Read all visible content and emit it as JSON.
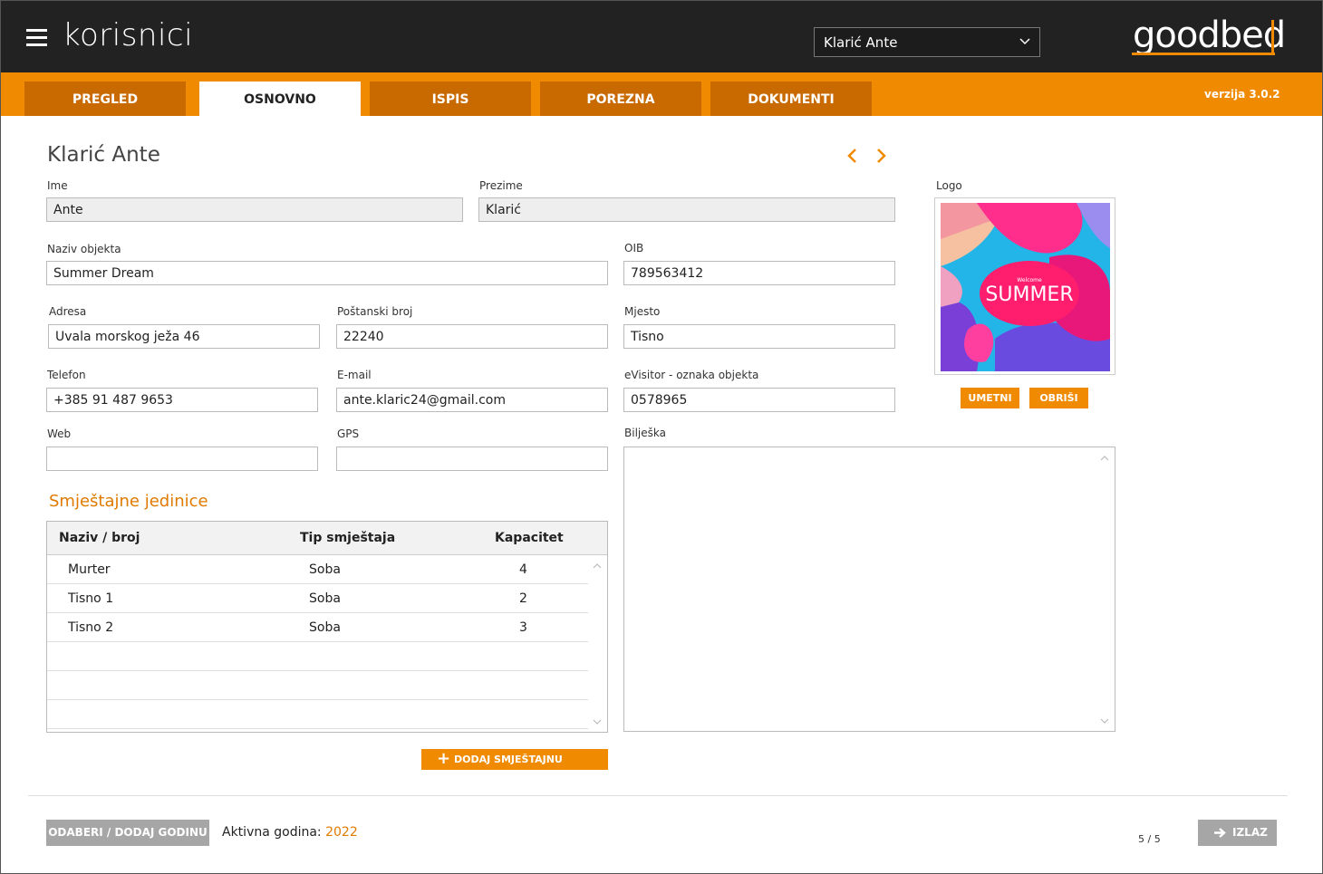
{
  "header": {
    "title": "korisnici",
    "user_select": "Klarić Ante",
    "logo": "goodbed"
  },
  "tabs": [
    {
      "label": "PREGLED"
    },
    {
      "label": "OSNOVNO",
      "active": true
    },
    {
      "label": "ISPIS"
    },
    {
      "label": "POREZNA"
    },
    {
      "label": "DOKUMENTI"
    }
  ],
  "version": "verzija 3.0.2",
  "form": {
    "title": "Klarić Ante",
    "ime_label": "Ime",
    "ime": "Ante",
    "prezime_label": "Prezime",
    "prezime": "Klarić",
    "naziv_label": "Naziv objekta",
    "naziv": "Summer Dream",
    "oib_label": "OIB",
    "oib": "789563412",
    "adresa_label": "Adresa",
    "adresa": "Uvala morskog ježa 46",
    "postanski_label": "Poštanski broj",
    "postanski": "22240",
    "mjesto_label": "Mjesto",
    "mjesto": "Tisno",
    "telefon_label": "Telefon",
    "telefon": "+385 91 487 9653",
    "email_label": "E-mail",
    "email": "ante.klaric24@gmail.com",
    "evisitor_label": "eVisitor - oznaka objekta",
    "evisitor": "0578965",
    "web_label": "Web",
    "web": "",
    "gps_label": "GPS",
    "gps": "",
    "biljeska_label": "Bilješka",
    "biljeska": ""
  },
  "logo_panel": {
    "label": "Logo",
    "image_text_small": "Welcome",
    "image_text": "SUMMER",
    "insert_label": "UMETNI",
    "delete_label": "OBRIŠI"
  },
  "units": {
    "title": "Smještajne jedinice",
    "columns": [
      "Naziv / broj",
      "Tip smještaja",
      "Kapacitet"
    ],
    "rows": [
      {
        "naziv": "Murter",
        "tip": "Soba",
        "kapacitet": "4"
      },
      {
        "naziv": "Tisno 1",
        "tip": "Soba",
        "kapacitet": "2"
      },
      {
        "naziv": "Tisno 2",
        "tip": "Soba",
        "kapacitet": "3"
      }
    ],
    "add_label": "DODAJ SMJEŠTAJNU JEDINICU"
  },
  "footer": {
    "select_year_label": "ODABERI / DODAJ GODINU",
    "active_year_label": "Aktivna godina:",
    "active_year": "2022",
    "pager": "5 / 5",
    "exit_label": "IZLAZ"
  },
  "colors": {
    "accent": "#f08a00",
    "tab_inactive": "#c86a00",
    "header_bg": "#222222",
    "button_gray": "#a6a6a6"
  }
}
